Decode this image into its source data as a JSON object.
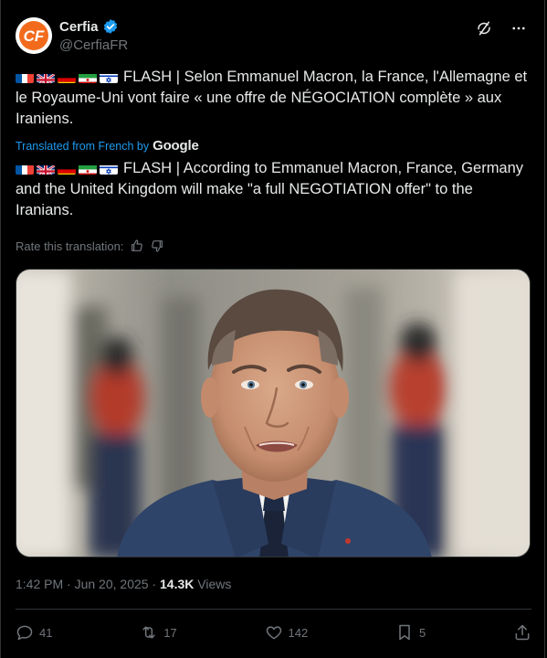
{
  "author": {
    "display_name": "Cerfia",
    "handle": "@CerfiaFR",
    "avatar_text": "CF",
    "verified_color": "#1d9bf0"
  },
  "top_icons": [
    "grok-icon",
    "more-icon"
  ],
  "flags": [
    "france",
    "united-kingdom",
    "germany",
    "iran",
    "israel"
  ],
  "original_text": "FLASH | Selon Emmanuel Macron, la France, l'Allemagne et le Royaume-Uni vont faire « une offre de NÉGOCIATION complète » aux Iraniens.",
  "translation_label": "Translated from French by",
  "translation_provider": "Google",
  "translated_text": "FLASH | According to Emmanuel Macron, France, Germany and the United Kingdom will make \"a full NEGOTIATION offer\" to the Iranians.",
  "rate_label": "Rate this translation:",
  "meta": {
    "time": "1:42 PM",
    "date": "Jun 20, 2025",
    "views_count": "14.3K",
    "views_label": "Views"
  },
  "actions": {
    "replies": "41",
    "reposts": "17",
    "likes": "142",
    "bookmarks": "5"
  },
  "colors": {
    "background": "#000000",
    "text": "#e7e9ea",
    "muted": "#71767b",
    "accent": "#1d9bf0",
    "divider": "#2f3336"
  }
}
